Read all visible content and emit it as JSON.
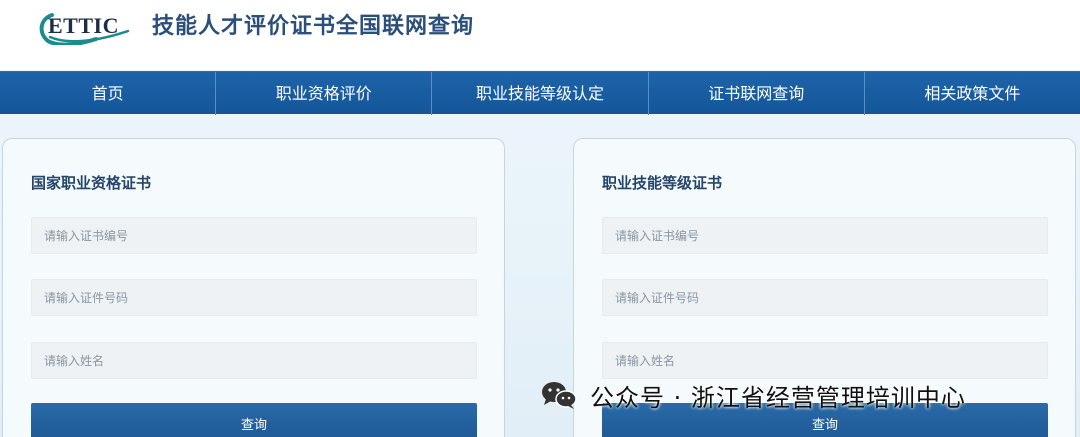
{
  "header": {
    "logo_text": "ETTIC",
    "title": "技能人才评价证书全国联网查询"
  },
  "nav": {
    "items": [
      "首页",
      "职业资格评价",
      "职业技能等级认定",
      "证书联网查询",
      "相关政策文件"
    ]
  },
  "panels": [
    {
      "title": "国家职业资格证书",
      "fields": [
        {
          "placeholder": "请输入证书编号"
        },
        {
          "placeholder": "请输入证件号码"
        },
        {
          "placeholder": "请输入姓名"
        }
      ],
      "button": "查询"
    },
    {
      "title": "职业技能等级证书",
      "fields": [
        {
          "placeholder": "请输入证书编号"
        },
        {
          "placeholder": "请输入证件号码"
        },
        {
          "placeholder": "请输入姓名"
        }
      ],
      "button": "查询"
    }
  ],
  "watermark": {
    "text": "公众号 · 浙江省经营管理培训中心",
    "icon": "wechat-icon"
  },
  "colors": {
    "nav_bg": "#1a5fa3",
    "title": "#2b4f7a",
    "logo_teal": "#1a8c8c",
    "button_bg": "#22629e"
  }
}
